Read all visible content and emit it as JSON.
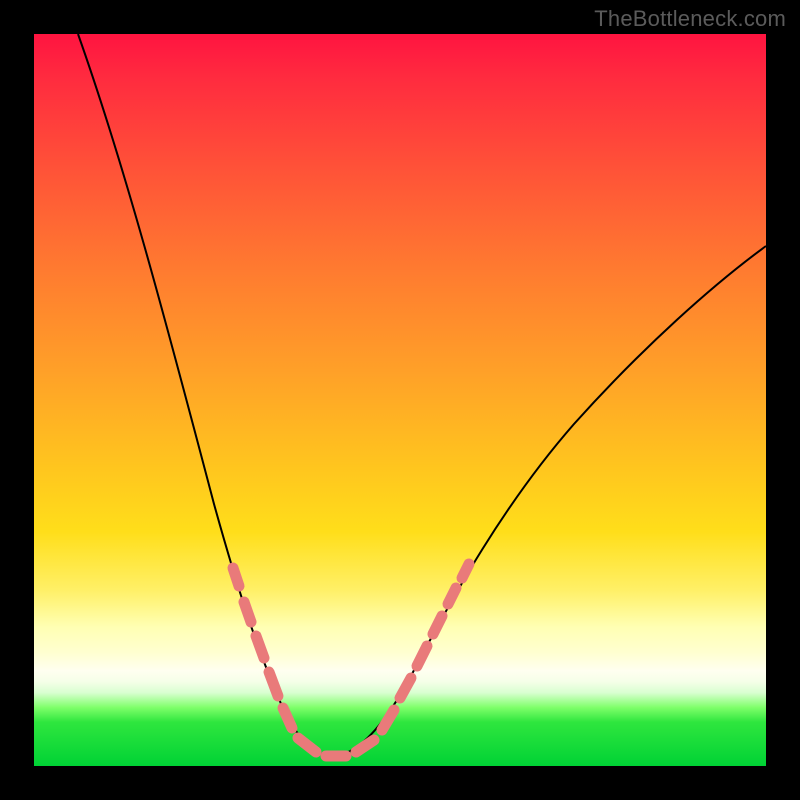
{
  "watermark": "TheBottleneck.com",
  "colors": {
    "frame": "#000000",
    "curve": "#000000",
    "dash": "#e97a7a",
    "gradient_top": "#ff1440",
    "gradient_bottom": "#00d235"
  },
  "chart_data": {
    "type": "line",
    "title": "",
    "xlabel": "",
    "ylabel": "",
    "xlim": [
      0,
      100
    ],
    "ylim": [
      0,
      100
    ],
    "series": [
      {
        "name": "bottleneck-curve",
        "x": [
          6,
          10,
          14,
          18,
          22,
          24,
          26,
          28,
          30,
          31,
          32,
          33,
          34,
          36,
          38,
          40,
          44,
          50,
          58,
          68,
          80,
          92,
          100
        ],
        "y": [
          100,
          84,
          68,
          54,
          40,
          33,
          27,
          21,
          15,
          12,
          9,
          6,
          4,
          2,
          1,
          1,
          3,
          8,
          16,
          27,
          40,
          54,
          63
        ]
      }
    ],
    "annotations": [
      {
        "name": "highlight-left-dashes",
        "x_range": [
          26,
          33
        ],
        "style": "salmon-dash"
      },
      {
        "name": "highlight-bottom-dashes",
        "x_range": [
          33,
          44
        ],
        "style": "salmon-dash"
      },
      {
        "name": "highlight-right-dashes",
        "x_range": [
          44,
          51
        ],
        "style": "salmon-dash"
      }
    ]
  }
}
